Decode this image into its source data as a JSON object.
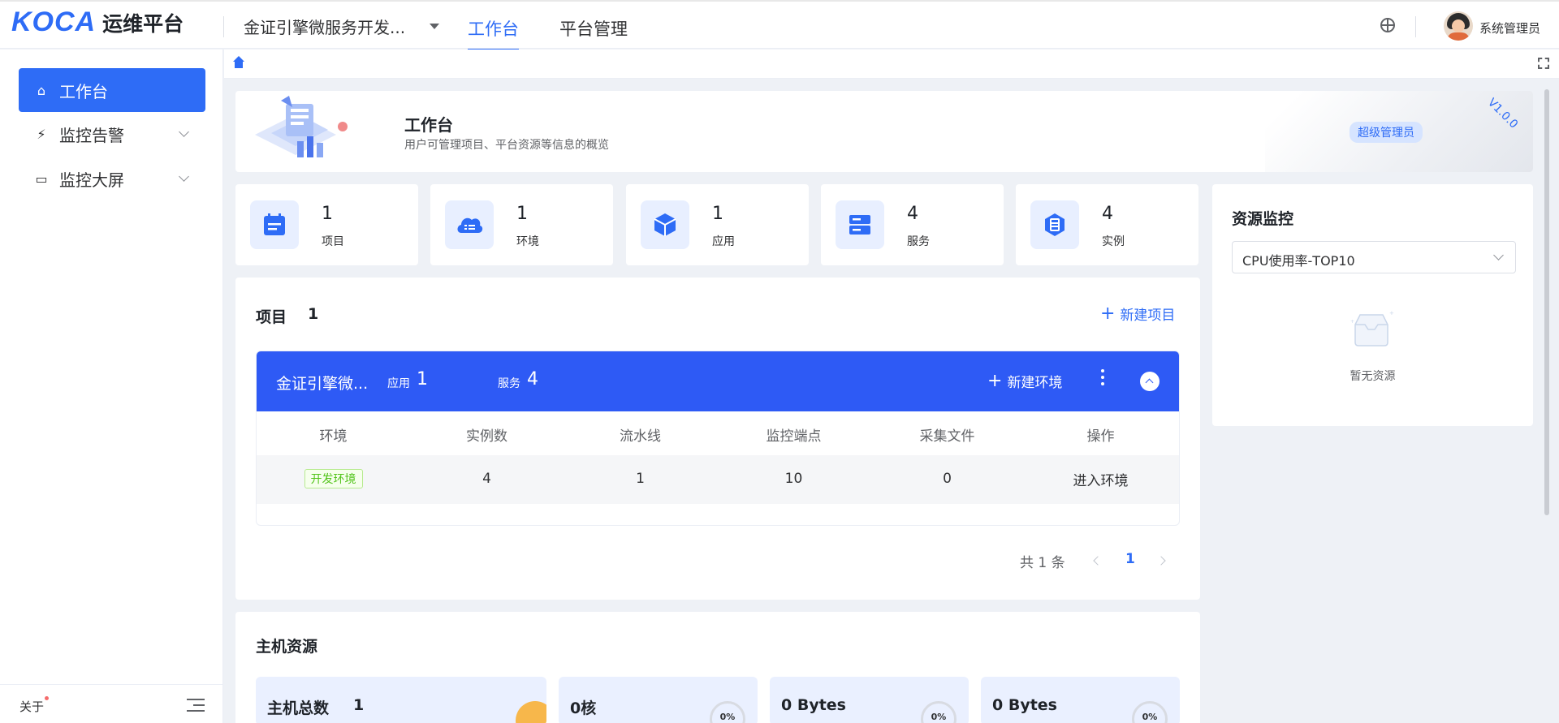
{
  "header": {
    "logo_mark": "KOCA",
    "logo_text": "运维平台",
    "project_select": "金证引擎微服务开发...",
    "tabs": [
      "工作台",
      "平台管理"
    ],
    "active_tab": "工作台",
    "user_name": "系统管理员"
  },
  "sidebar": {
    "items": [
      {
        "label": "工作台",
        "icon": "home-icon"
      },
      {
        "label": "监控告警",
        "icon": "alarm-icon"
      },
      {
        "label": "监控大屏",
        "icon": "screen-icon"
      }
    ],
    "footer_about": "关于"
  },
  "banner": {
    "title": "工作台",
    "subtitle": "用户可管理项目、平台资源等信息的概览",
    "badge": "超级管理员",
    "version": "V1.0.0"
  },
  "stats": [
    {
      "value": "1",
      "label": "项目",
      "icon": "calendar-icon"
    },
    {
      "value": "1",
      "label": "环境",
      "icon": "cloud-icon"
    },
    {
      "value": "1",
      "label": "应用",
      "icon": "cube-icon"
    },
    {
      "value": "4",
      "label": "服务",
      "icon": "server-icon"
    },
    {
      "value": "4",
      "label": "实例",
      "icon": "instance-icon"
    }
  ],
  "projects": {
    "title": "项目",
    "count": "1",
    "new_button": "新建项目",
    "card": {
      "name": "金证引擎微...",
      "app_label": "应用",
      "app_count": "1",
      "service_label": "服务",
      "service_count": "4",
      "new_env": "新建环境"
    },
    "columns": [
      "环境",
      "实例数",
      "流水线",
      "监控端点",
      "采集文件",
      "操作"
    ],
    "row": {
      "env": "开发环境",
      "instances": "4",
      "pipelines": "1",
      "endpoints": "10",
      "files": "0",
      "action": "进入环境"
    },
    "pager": {
      "total": "共 1 条",
      "page": "1"
    }
  },
  "resource_monitor": {
    "title": "资源监控",
    "select_value": "CPU使用率-TOP10",
    "empty_text": "暂无资源"
  },
  "host": {
    "title": "主机资源",
    "tiles": [
      {
        "label": "主机总数",
        "value": "1"
      },
      {
        "value": "0核",
        "gauge": "0%"
      },
      {
        "value": "0 Bytes",
        "gauge": "0%"
      },
      {
        "value": "0 Bytes",
        "gauge": "0%"
      }
    ]
  },
  "colors": {
    "primary": "#2e6cf6",
    "header_blue": "#2e5af5",
    "success": "#52c41a"
  }
}
